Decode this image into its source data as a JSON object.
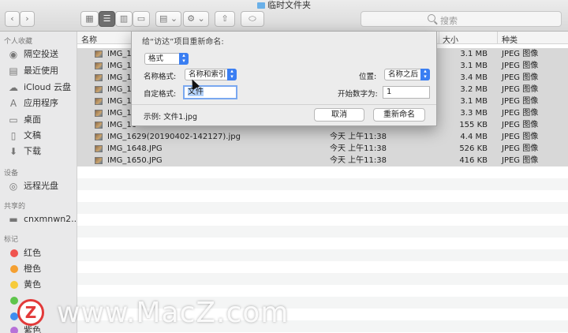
{
  "window": {
    "title": "临时文件夹"
  },
  "toolbar": {
    "back": "‹",
    "forward": "›",
    "view_icon": "▦",
    "view_list": "☰",
    "view_column": "▥",
    "view_gallery": "▭",
    "group": "▤ ⌄",
    "action": "⚙ ⌄",
    "share": "⇧",
    "tag": "⬭",
    "search_placeholder": "搜索"
  },
  "sidebar": {
    "favorites_header": "个人收藏",
    "favorites": [
      {
        "label": "隔空投送",
        "icon": "◉"
      },
      {
        "label": "最近使用",
        "icon": "▤"
      },
      {
        "label": "iCloud 云盘",
        "icon": "☁"
      },
      {
        "label": "应用程序",
        "icon": "A"
      },
      {
        "label": "桌面",
        "icon": "▭"
      },
      {
        "label": "文稿",
        "icon": "▯"
      },
      {
        "label": "下载",
        "icon": "⬇"
      }
    ],
    "devices_header": "设备",
    "devices": [
      {
        "label": "远程光盘",
        "icon": "◎"
      }
    ],
    "shared_header": "共享的",
    "shared": [
      {
        "label": "cnxmnwn2...",
        "icon": "▬"
      }
    ],
    "tags_header": "标记",
    "tags": [
      {
        "label": "红色",
        "color": "#f0544e"
      },
      {
        "label": "橙色",
        "color": "#f5a031"
      },
      {
        "label": "黄色",
        "color": "#f6cb3b"
      },
      {
        "label": "",
        "color": "#5fc54c"
      },
      {
        "label": "",
        "color": "#3f8ef1"
      },
      {
        "label": "紫色",
        "color": "#b771d8"
      }
    ]
  },
  "list": {
    "headers": {
      "name": "名称",
      "size": "大小",
      "kind": "种类"
    },
    "rows": [
      {
        "name": "IMG_15",
        "date": "",
        "size": "3.1 MB",
        "kind": "JPEG 图像"
      },
      {
        "name": "IMG_15",
        "date": "",
        "size": "3.1 MB",
        "kind": "JPEG 图像"
      },
      {
        "name": "IMG_15",
        "date": "",
        "size": "3.4 MB",
        "kind": "JPEG 图像"
      },
      {
        "name": "IMG_15",
        "date": "",
        "size": "3.2 MB",
        "kind": "JPEG 图像"
      },
      {
        "name": "IMG_15",
        "date": "",
        "size": "3.1 MB",
        "kind": "JPEG 图像"
      },
      {
        "name": "IMG_16",
        "date": "",
        "size": "3.3 MB",
        "kind": "JPEG 图像"
      },
      {
        "name": "IMG_16",
        "date": "",
        "size": "155 KB",
        "kind": "JPEG 图像"
      },
      {
        "name": "IMG_1629(20190402-142127).jpg",
        "date": "今天 上午11:38",
        "size": "4.4 MB",
        "kind": "JPEG 图像"
      },
      {
        "name": "IMG_1648.JPG",
        "date": "今天 上午11:38",
        "size": "526 KB",
        "kind": "JPEG 图像"
      },
      {
        "name": "IMG_1650.JPG",
        "date": "今天 上午11:38",
        "size": "416 KB",
        "kind": "JPEG 图像"
      }
    ]
  },
  "dialog": {
    "title": "给“访达”项目重新命名:",
    "format_popup": "格式",
    "name_format_label": "名称格式:",
    "name_format_value": "名称和索引",
    "position_label": "位置:",
    "position_value": "名称之后",
    "custom_format_label": "自定格式:",
    "custom_format_value": "文件",
    "start_number_label": "开始数字为:",
    "start_number_value": "1",
    "example_label": "示例: 文件1.jpg",
    "cancel": "取消",
    "rename": "重新命名"
  },
  "watermark": {
    "logo_letter": "Z",
    "text": "www.MacZ.com"
  }
}
